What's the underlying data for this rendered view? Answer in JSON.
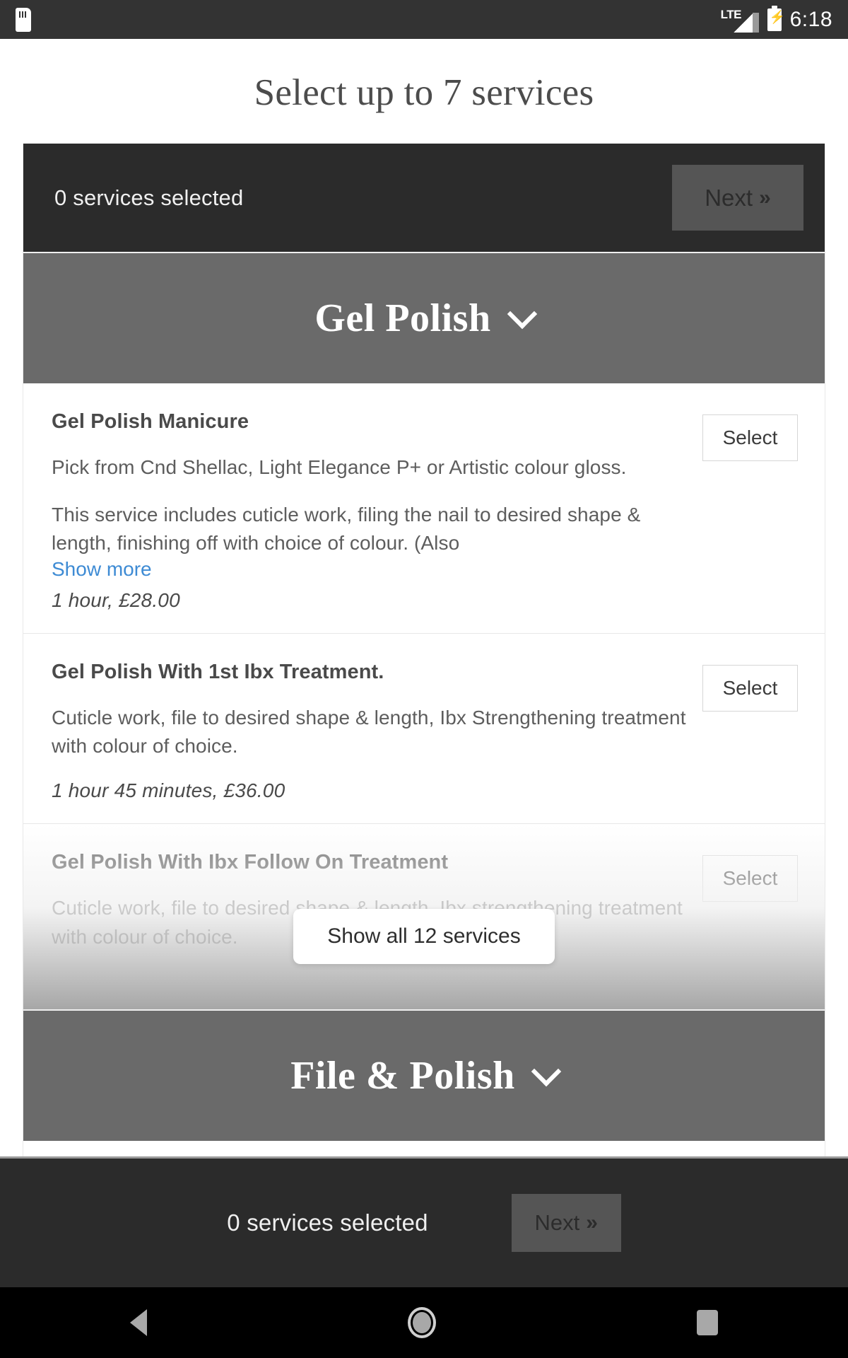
{
  "status_bar": {
    "sd_icon": "sd-card-icon",
    "network_label": "LTE",
    "signal_icon": "signal-bars-icon",
    "battery_icon": "battery-charging-icon",
    "time": "6:18"
  },
  "page_title": "Select up to 7 services",
  "selection_bar": {
    "status_text": "0 services selected",
    "next_label": "Next",
    "next_chevron": "»"
  },
  "categories": [
    {
      "name": "Gel Polish",
      "chevron": "chevron-down-icon",
      "services": [
        {
          "name": "Gel Polish Manicure",
          "desc1": "Pick from Cnd Shellac, Light Elegance P+ or Artistic colour gloss.",
          "desc2": "This service includes cuticle work, filing the nail to desired shape & length, finishing off with choice of colour. (Also",
          "show_more": "Show more",
          "price": "1 hour, £28.00",
          "select_label": "Select"
        },
        {
          "name": "Gel Polish With 1st Ibx Treatment.",
          "desc1": "Cuticle work, file to desired shape & length, Ibx Strengthening treatment with colour of choice.",
          "price": "1 hour 45 minutes, £36.00",
          "select_label": "Select"
        },
        {
          "name": "Gel Polish With Ibx Follow On Treatment",
          "desc1": "Cuticle work, file to desired shape & length, Ibx strengthening treatment with colour of choice.",
          "select_label": "Select"
        }
      ],
      "show_all_label": "Show all 12 services"
    },
    {
      "name": "File & Polish",
      "chevron": "chevron-down-icon"
    }
  ],
  "bottom_bar": {
    "status_text": "0 services selected",
    "next_label": "Next",
    "next_chevron": "»"
  },
  "nav_bar": {
    "back": "back-triangle-icon",
    "home": "home-circle-icon",
    "recent": "recents-square-icon"
  },
  "colors": {
    "status_bar_bg": "#333333",
    "dark_bar_bg": "#2b2b2b",
    "category_header_bg": "#6a6a6a",
    "link_blue": "#3e8bd4",
    "next_btn_bg": "#555555"
  }
}
